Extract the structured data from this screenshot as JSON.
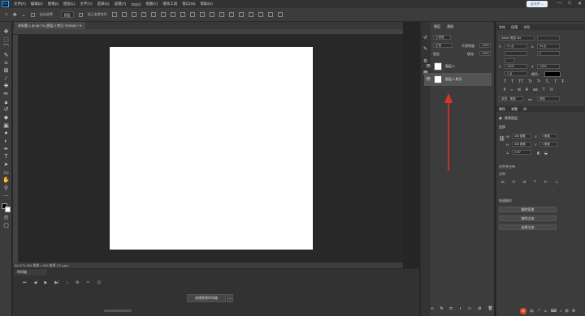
{
  "app": {
    "logo": "Ps"
  },
  "menu": [
    "文件(F)",
    "编辑(E)",
    "图像(I)",
    "图层(L)",
    "文字(Y)",
    "选择(S)",
    "滤镜(T)",
    "3D(D)",
    "视图(V)",
    "增效工具",
    "窗口(W)",
    "帮助(H)"
  ],
  "window_controls": [
    "—",
    "□",
    "✕"
  ],
  "cloud_badge": "云文件 ⌄",
  "options_bar": {
    "auto_select_label": "自动选择：",
    "auto_select_value": "图层",
    "show_transform_label": "显示变换控件"
  },
  "document": {
    "tab_title": "未标题-1 @ 66.7% (图层 0 拷贝, RGB/8) * ✕",
    "status": "66.67%    360 像素 x 360 像素 (72 ppi)    ›"
  },
  "timeline": {
    "tab": "时间轴",
    "create_button": "创建视频时间轴",
    "arrow": "⌄"
  },
  "layers": {
    "tabs": [
      "图层",
      "通道"
    ],
    "kind_label": "Q 类型",
    "blend_mode": "正常",
    "opacity_label": "不透明度:",
    "opacity_value": "100%",
    "lock_label": "锁定:",
    "fill_label": "填充:",
    "fill_value": "100%",
    "items": [
      {
        "name": "图层 0",
        "visible": true,
        "selected": false
      },
      {
        "name": "图层 0 拷贝",
        "visible": true,
        "selected": true
      }
    ]
  },
  "character": {
    "tabs": [
      "字符",
      "段落",
      "字形"
    ],
    "font": "Adobe 黑体 Std",
    "size": "21 点",
    "leading": "34 点",
    "tracking": "0",
    "scale_v": "100%",
    "scale_h": "100%",
    "kerning": "0 点",
    "color_label": "颜色:",
    "language": "英语：美国",
    "aa_label": "锐利"
  },
  "properties": {
    "tabs": [
      "属性",
      "调整",
      "库"
    ],
    "type_label": "像素图层",
    "transform_label": "变换",
    "w": "360 像素",
    "h": "360 像素",
    "x": "0 像素",
    "y": "0 像素",
    "angle": "0.00°",
    "align_label": "对齐并分布",
    "align_sub": "对齐:",
    "quick_actions_label": "快速操作",
    "buttons": [
      "删除背景",
      "移除主体",
      "选择主体"
    ]
  },
  "tray": [
    "S",
    "中",
    "·°",
    "☺",
    "⌨",
    "♪",
    "⊞",
    "⚙"
  ]
}
